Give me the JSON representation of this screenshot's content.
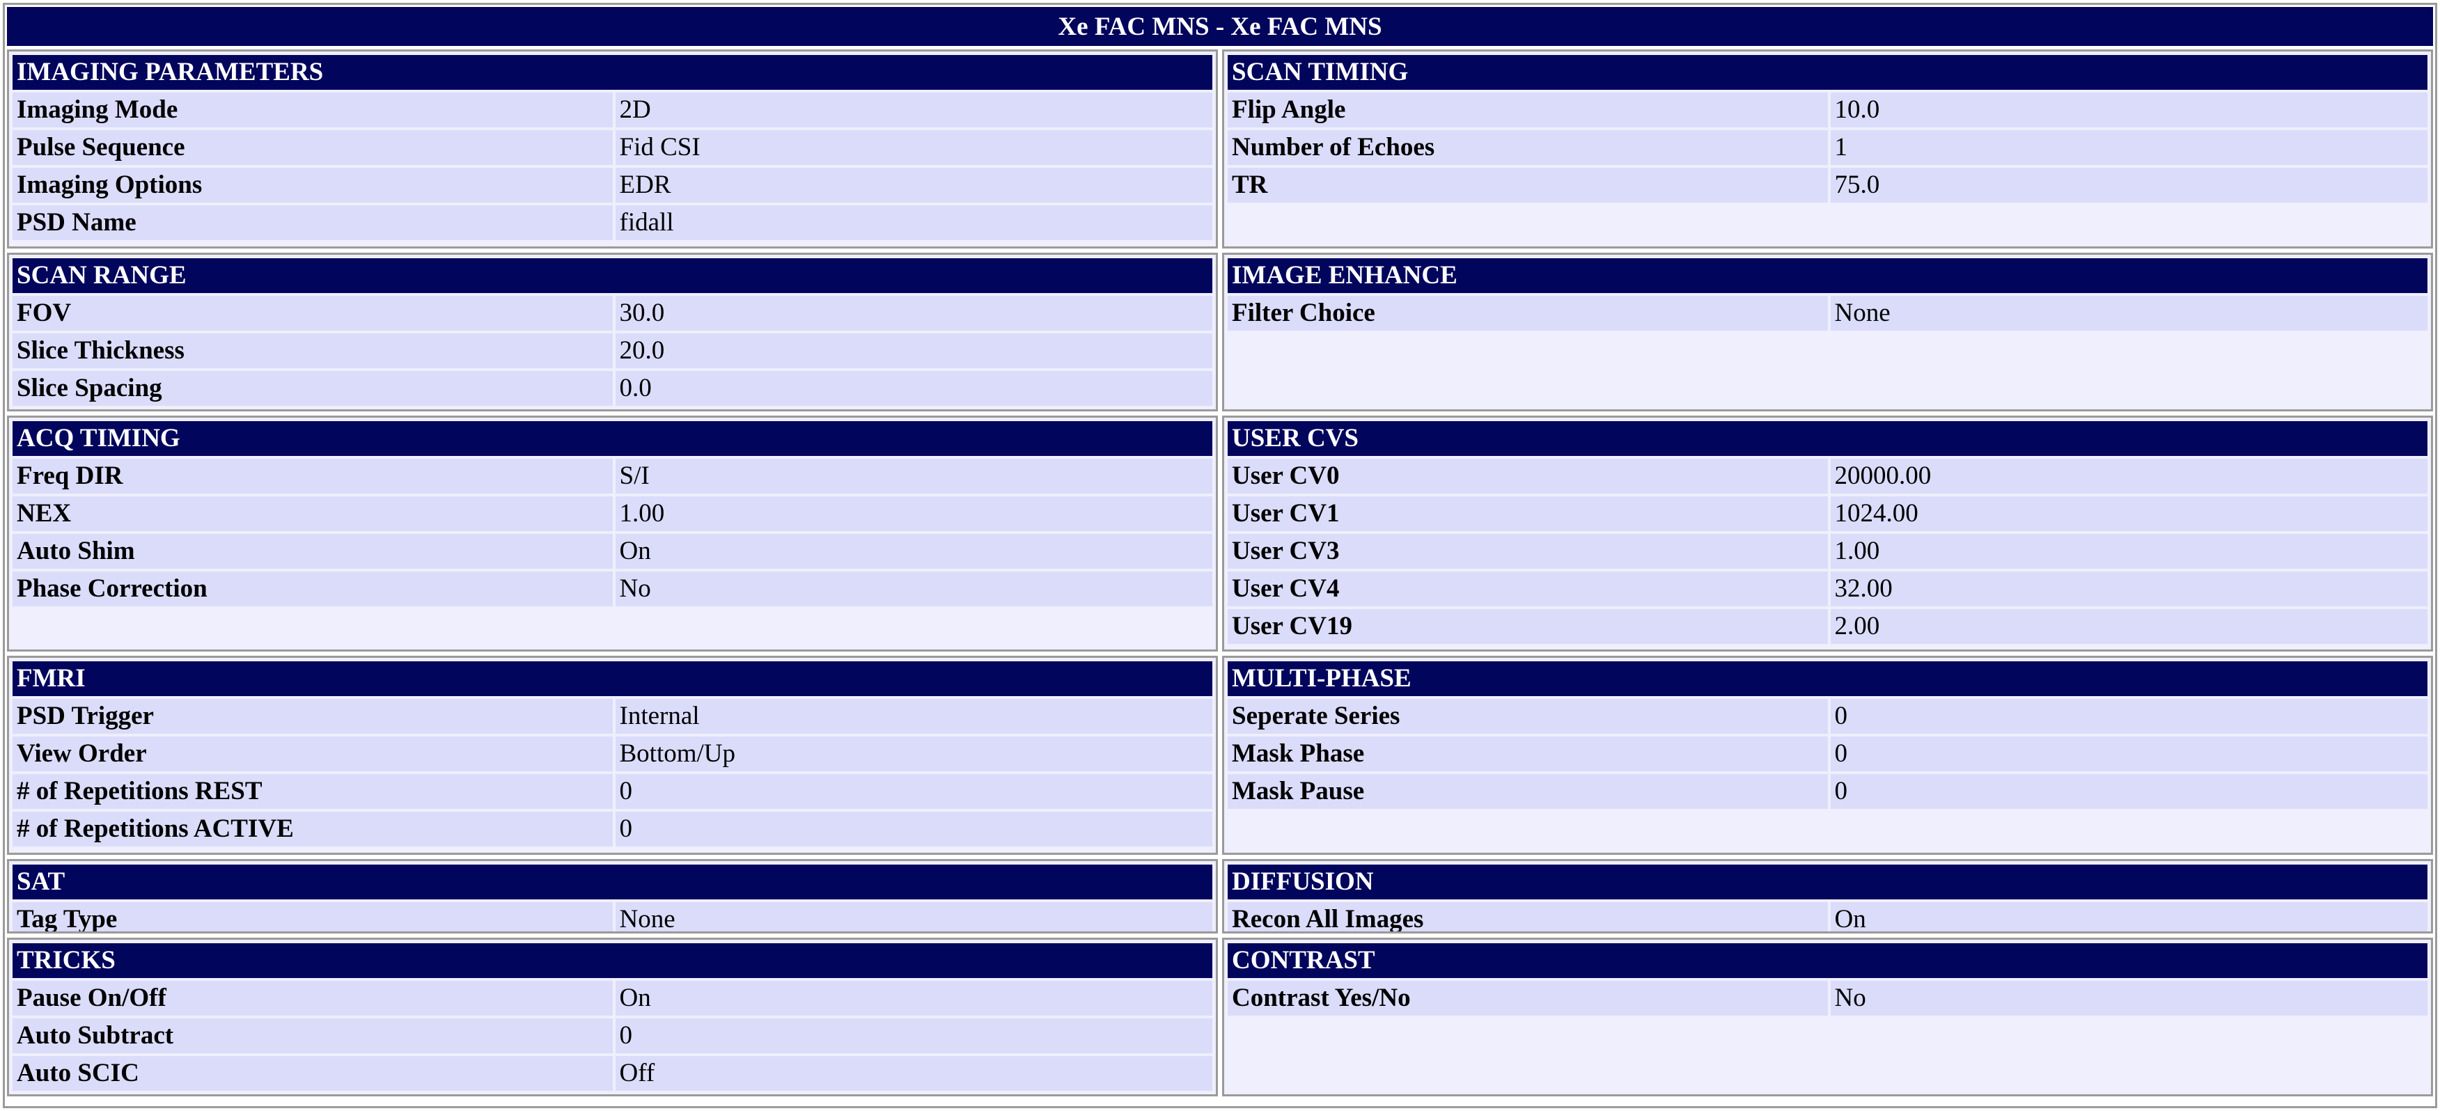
{
  "title": "Xe FAC MNS - Xe FAC MNS",
  "sections": [
    {
      "header": "IMAGING PARAMETERS",
      "rows": [
        [
          "Imaging Mode",
          "2D"
        ],
        [
          "Pulse Sequence",
          "Fid CSI"
        ],
        [
          "Imaging Options",
          "EDR"
        ],
        [
          "PSD Name",
          "fidall"
        ]
      ]
    },
    {
      "header": "SCAN TIMING",
      "rows": [
        [
          "Flip Angle",
          "10.0"
        ],
        [
          "Number of Echoes",
          "1"
        ],
        [
          "TR",
          "75.0"
        ]
      ]
    },
    {
      "header": "SCAN RANGE",
      "rows": [
        [
          "FOV",
          "30.0"
        ],
        [
          "Slice Thickness",
          "20.0"
        ],
        [
          "Slice Spacing",
          "0.0"
        ]
      ]
    },
    {
      "header": "IMAGE ENHANCE",
      "rows": [
        [
          "Filter Choice",
          "None"
        ]
      ]
    },
    {
      "header": "ACQ TIMING",
      "rows": [
        [
          "Freq DIR",
          "S/I"
        ],
        [
          "NEX",
          "1.00"
        ],
        [
          "Auto Shim",
          "On"
        ],
        [
          "Phase Correction",
          "No"
        ]
      ]
    },
    {
      "header": "USER CVS",
      "rows": [
        [
          "User CV0",
          "20000.00"
        ],
        [
          "User CV1",
          "1024.00"
        ],
        [
          "User CV3",
          "1.00"
        ],
        [
          "User CV4",
          "32.00"
        ],
        [
          "User CV19",
          "2.00"
        ]
      ]
    },
    {
      "header": "FMRI",
      "rows": [
        [
          "PSD Trigger",
          "Internal"
        ],
        [
          "View Order",
          "Bottom/Up"
        ],
        [
          "# of Repetitions REST",
          "0"
        ],
        [
          "# of Repetitions ACTIVE",
          "0"
        ]
      ]
    },
    {
      "header": "MULTI-PHASE",
      "rows": [
        [
          "Seperate Series",
          "0"
        ],
        [
          "Mask Phase",
          "0"
        ],
        [
          "Mask Pause",
          "0"
        ]
      ]
    },
    {
      "header": "SAT",
      "rows": [
        [
          "Tag Type",
          "None"
        ]
      ]
    },
    {
      "header": "DIFFUSION",
      "rows": [
        [
          "Recon All Images",
          "On"
        ]
      ]
    },
    {
      "header": "TRICKS",
      "rows": [
        [
          "Pause On/Off",
          "On"
        ],
        [
          "Auto Subtract",
          "0"
        ],
        [
          "Auto SCIC",
          "Off"
        ]
      ]
    },
    {
      "header": "CONTRAST",
      "rows": [
        [
          "Contrast Yes/No",
          "No"
        ]
      ]
    }
  ]
}
